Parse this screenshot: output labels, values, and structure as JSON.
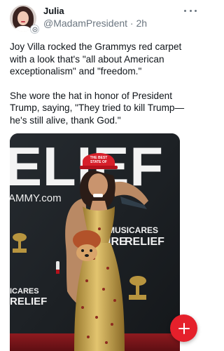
{
  "post": {
    "author_name": "Julia",
    "handle": "@MadamPresident",
    "separator": " · ",
    "time": "2h",
    "paragraphs": [
      "Joy Villa rocked the Grammys red carpet with a look that's \"all about American exceptionalism\" and \"freedom.\"",
      "She wore the hat in honor of President Trump, saying, \"They tried to kill Trump—he's still alive, thank God.\""
    ]
  },
  "media": {
    "backdrop_texts": {
      "relief_large": "ELIEF",
      "grammy_url": "AMMY.com",
      "musicares_top": "MUSICARES",
      "musicares_bottom": "RELIEF",
      "musicares_prefix": "IRE",
      "bottom_left_top": "ICARES",
      "bottom_left_bottom": "RELIEF"
    },
    "hat_text": [
      "THE BEST",
      "STATE OF"
    ],
    "dress_color": "#c9a64b",
    "backdrop_color": "#1e2226"
  },
  "icons": {
    "more": "more-horizontal-icon",
    "verified": "badge-icon",
    "compose": "plus-icon"
  },
  "colors": {
    "accent": "#e5202b",
    "text_secondary": "#6b7680",
    "text_primary": "#0f1419"
  }
}
